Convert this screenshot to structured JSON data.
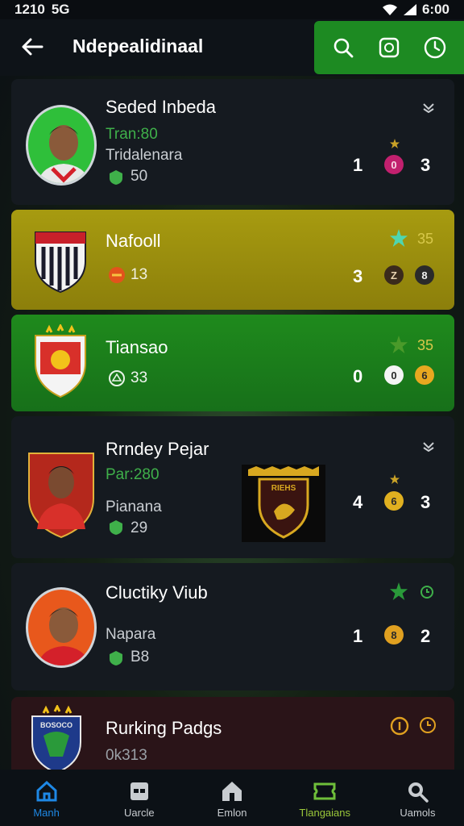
{
  "status": {
    "time": "1210",
    "sim": "5G",
    "battery_time": "6:00"
  },
  "appbar": {
    "title": "Ndepealidinaal"
  },
  "cards": [
    {
      "name": "Seded Inbeda",
      "line1": "Tran:80",
      "line2": "Tridalenara",
      "stat": "50",
      "score_left": "1",
      "chip": "0",
      "score_right": "3"
    },
    {
      "name": "Nafooll",
      "stat": "13",
      "rating": "35",
      "score_left": "3",
      "chip1": "Z",
      "chip2": "8"
    },
    {
      "name": "Tiansao",
      "stat": "33",
      "rating": "35",
      "score_left": "0",
      "chip1": "0",
      "chip2": "6"
    },
    {
      "name": "Rrndey Pejar",
      "line1": "Par:280",
      "line2": "Pianana",
      "stat": "29",
      "badge_text": "RIEHS",
      "score_left": "4",
      "chip": "6",
      "score_right": "3"
    },
    {
      "name": "Cluctiky Viub",
      "line2": "Napara",
      "stat": "B8",
      "score_left": "1",
      "chip": "8",
      "score_right": "2"
    },
    {
      "name": "Rurking Padgs",
      "line1": "0k313",
      "crest_text": "BOSOCO"
    }
  ],
  "nav": [
    {
      "label": "Manh"
    },
    {
      "label": "Uarcle"
    },
    {
      "label": "Emlon"
    },
    {
      "label": "Tlangaians"
    },
    {
      "label": "Uamols"
    }
  ],
  "colors": {
    "accent_green": "#1d8a22",
    "gold": "#a79b10",
    "active_nav": "#1e88e5"
  }
}
